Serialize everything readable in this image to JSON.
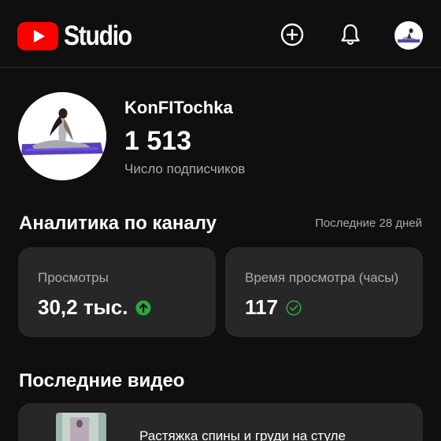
{
  "header": {
    "logo_text": "Studio",
    "create_icon": "add-circle-icon",
    "notifications_icon": "bell-icon",
    "account_icon": "avatar"
  },
  "channel": {
    "name": "KonFITochka",
    "subscribers": "1 513",
    "subscribers_label": "Число подписчиков"
  },
  "analytics": {
    "title": "Аналитика по каналу",
    "range": "Последние 28 дней",
    "cards": [
      {
        "label": "Просмотры",
        "value": "30,2 тыс.",
        "status_icon": "arrow-up-circle-icon",
        "status_color": "#2ba640"
      },
      {
        "label": "Время просмотра (часы)",
        "value": "117",
        "status_icon": "check-circle-icon",
        "status_color": "#2ba640"
      }
    ]
  },
  "recent_videos": {
    "title": "Последние видео",
    "items": [
      {
        "title": "Растяжка спины и груди на стуле"
      }
    ]
  },
  "colors": {
    "background": "#0f0f0f",
    "card": "#272727",
    "brand_red": "#ff0000",
    "positive": "#2ba640"
  }
}
